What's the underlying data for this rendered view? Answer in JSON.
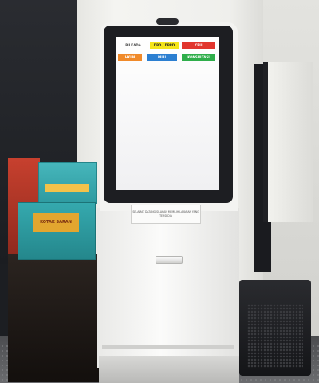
{
  "kiosk": {
    "screen_buttons": [
      {
        "label": "PILKADA",
        "color": "#ffffff"
      },
      {
        "label": "DPD / DPRD",
        "color": "#f5e51a"
      },
      {
        "label": "CPU",
        "color": "#e1352d"
      },
      {
        "label": "HKLN",
        "color": "#f08a2a"
      },
      {
        "label": "PILU",
        "color": "#2c7fd1"
      },
      {
        "label": "KONSULTASI",
        "color": "#2fae4b"
      }
    ],
    "sign_text": "SELAMAT DATANG SILAKAN MEMILIH LAYANAN YANG TERSEDIA"
  },
  "donation_box": {
    "label": "KOTAK SARAN"
  }
}
